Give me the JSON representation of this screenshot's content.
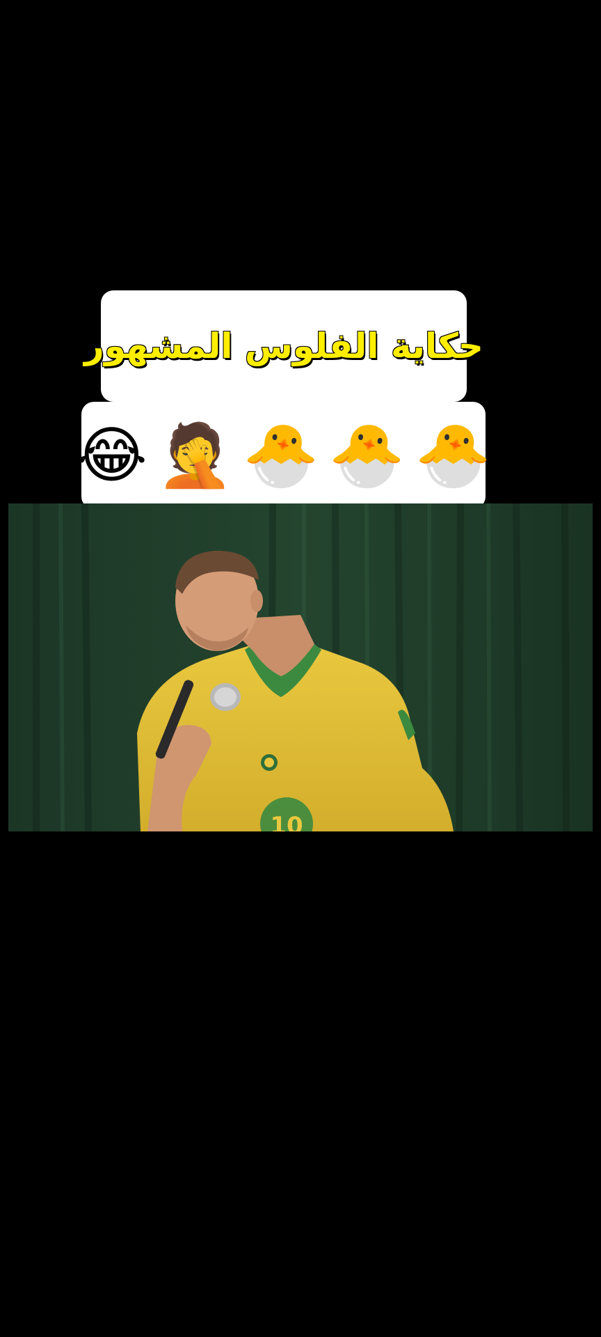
{
  "title_card": {
    "text": "حكاية الفلوس المشهور"
  },
  "emoji_row": {
    "items": [
      "😂",
      "🤦",
      "🐣",
      "🐣",
      "🐣"
    ]
  },
  "video": {
    "description": "",
    "jersey_number": "10"
  },
  "colors": {
    "background": "#000000",
    "title_fill": "#ffee00",
    "title_stroke": "#000000",
    "card_background": "#ffffff",
    "curtain_green": "#1e3a27",
    "jersey_yellow": "#e7c43a",
    "jersey_green": "#3c8a3f"
  }
}
